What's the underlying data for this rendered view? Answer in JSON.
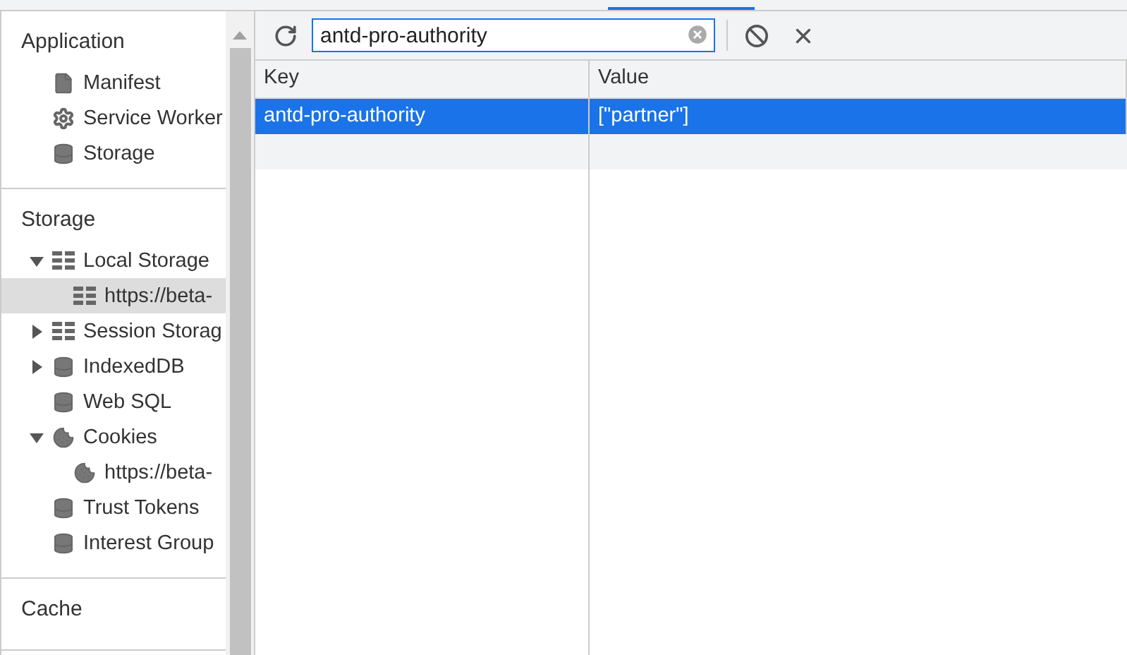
{
  "sidebar": {
    "sections": [
      {
        "title": "Application",
        "items": [
          {
            "label": "Manifest",
            "kind": "file",
            "selected": false
          },
          {
            "label": "Service Worker",
            "kind": "gear",
            "selected": false
          },
          {
            "label": "Storage",
            "kind": "database",
            "selected": false
          }
        ]
      },
      {
        "title": "Storage",
        "items": [
          {
            "label": "Local Storage",
            "kind": "grid",
            "expanded": true,
            "selected": false,
            "children": [
              {
                "label": "https://beta-",
                "kind": "grid",
                "selected": true
              }
            ]
          },
          {
            "label": "Session Storag",
            "kind": "grid",
            "expanded": false,
            "selected": false
          },
          {
            "label": "IndexedDB",
            "kind": "database",
            "expanded": false,
            "selected": false
          },
          {
            "label": "Web SQL",
            "kind": "database",
            "selected": false
          },
          {
            "label": "Cookies",
            "kind": "cookie",
            "expanded": true,
            "selected": false,
            "children": [
              {
                "label": "https://beta-",
                "kind": "cookie",
                "selected": false
              }
            ]
          },
          {
            "label": "Trust Tokens",
            "kind": "database",
            "selected": false
          },
          {
            "label": "Interest Group",
            "kind": "database",
            "selected": false
          }
        ]
      },
      {
        "title": "Cache"
      }
    ]
  },
  "search": {
    "value": "antd-pro-authority"
  },
  "table": {
    "columns": [
      "Key",
      "Value"
    ],
    "rows": [
      {
        "cells": [
          "antd-pro-authority",
          "[\"partner\"]"
        ],
        "selected": true
      }
    ]
  }
}
